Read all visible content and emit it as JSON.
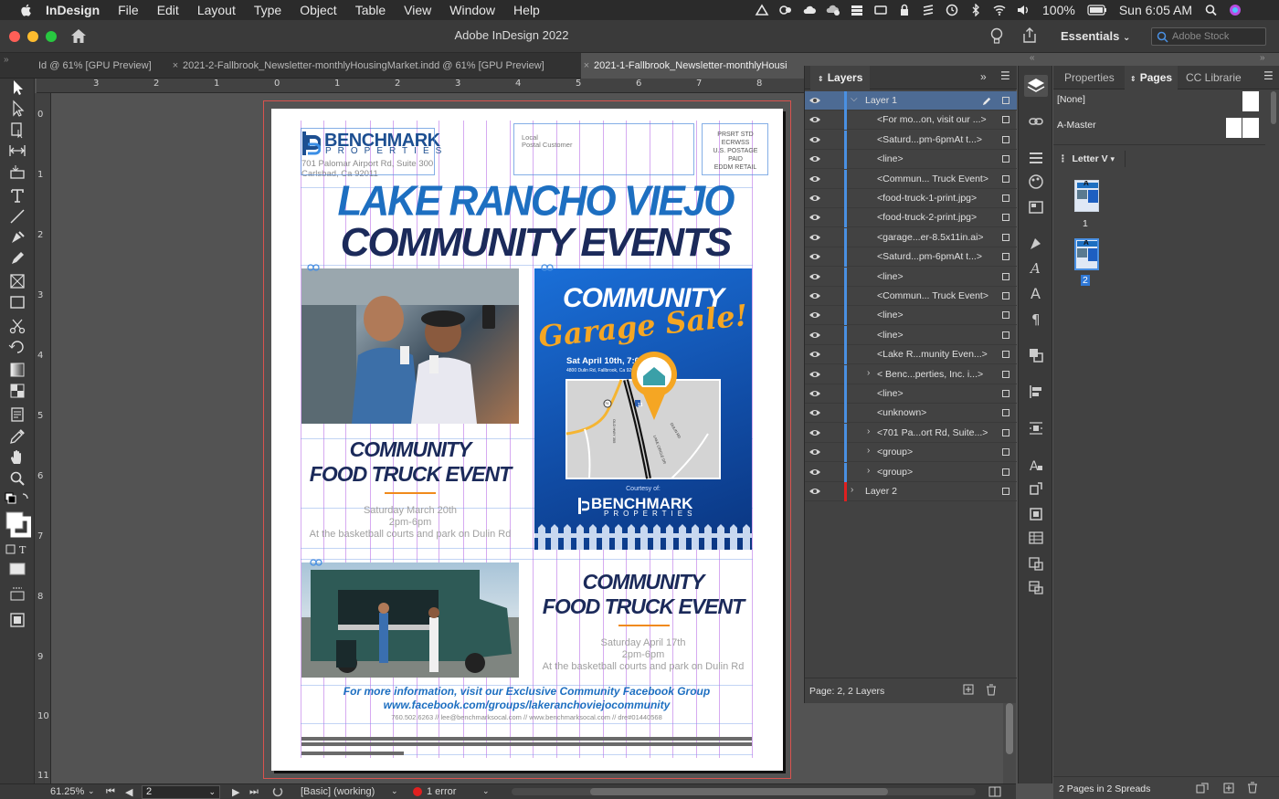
{
  "menubar": {
    "app_name": "InDesign",
    "items": [
      "File",
      "Edit",
      "Layout",
      "Type",
      "Object",
      "Table",
      "View",
      "Window",
      "Help"
    ],
    "battery": "100%",
    "clock": "Sun 6:05 AM"
  },
  "window": {
    "title": "Adobe InDesign 2022",
    "workspace": "Essentials",
    "search_placeholder": "Adobe Stock"
  },
  "tabs": [
    {
      "label": "Id @ 61% [GPU Preview]"
    },
    {
      "label": "2021-2-Fallbrook_Newsletter-monthlyHousingMarket.indd @ 61% [GPU Preview]"
    },
    {
      "label": "2021-1-Fallbrook_Newsletter-monthlyHousi"
    }
  ],
  "ruler": {
    "h_ticks": [
      "3",
      "2",
      "1",
      "0",
      "1",
      "2",
      "3",
      "4",
      "5",
      "6",
      "7",
      "8"
    ],
    "v_ticks": [
      "0",
      "1",
      "2",
      "3",
      "4",
      "5",
      "6",
      "7",
      "8",
      "9",
      "10",
      "11"
    ]
  },
  "newsletter": {
    "logo_name": "BENCHMARK",
    "logo_sub": "PROPERTIES",
    "address1": "701 Palomar Airport Rd, Suite 300",
    "address2": "Carlsbad, Ca 92011",
    "postal_line1": "Local",
    "postal_line2": "Postal Customer",
    "prsrt": [
      "PRSRT STD",
      "ECRWSS",
      "U.S. POSTAGE",
      "PAID",
      "EDDM RETAIL"
    ],
    "headline1": "LAKE RANCHO VIEJO",
    "headline2": "COMMUNITY EVENTS",
    "event1_title1": "COMMUNITY",
    "event1_title2": "FOOD TRUCK EVENT",
    "event1_date": "Saturday March 20th",
    "event1_time": "2pm-6pm",
    "event1_place": "At the basketball courts and park on Dulin Rd",
    "event2_title1": "COMMUNITY",
    "event2_title2": "FOOD TRUCK EVENT",
    "event2_date": "Saturday April 17th",
    "event2_time": "2pm-6pm",
    "event2_place": "At the basketball courts and park on Dulin Rd",
    "fb_line1": "For more information, visit our Exclusive Community Facebook Group",
    "fb_line2": "www.facebook.com/groups/lakeranchoviejocommunity",
    "contact": "760.502.6263  //  lee@benchmarksocal.com  //  www.benchmarksocal.com  //  dre#01440568"
  },
  "poster": {
    "title": "COMMUNITY",
    "script": "Garage Sale!",
    "date": "Sat April 10th, 7:00am",
    "address": "4800 Dulin Rd, Fallbrook, Ca 92028",
    "courtesy": "Courtesy of:",
    "brand": "BENCHMARK",
    "brand_sub": "PROPERTIES",
    "road_badge1": "76",
    "road_badge2": "15",
    "street1": "OLD HWY 395",
    "street2": "LAKE CIRCLE DR",
    "street3": "DULIN RD"
  },
  "statusbar": {
    "zoom": "61.25%",
    "page": "2",
    "preflight_profile": "[Basic] (working)",
    "errors": "1 error"
  },
  "layers": {
    "tab": "Layers",
    "rows": [
      {
        "label": "Layer 1",
        "level": 0,
        "expand": "open",
        "selected": true,
        "color": "#4a90e2"
      },
      {
        "label": "<For mo...on, visit our ...>",
        "level": 1,
        "expand": "",
        "color": "#4a90e2"
      },
      {
        "label": "<Saturd...pm-6pmAt t...>",
        "level": 1,
        "expand": "",
        "color": "#4a90e2"
      },
      {
        "label": "<line>",
        "level": 1,
        "expand": "",
        "color": "#4a90e2"
      },
      {
        "label": "<Commun... Truck Event>",
        "level": 1,
        "expand": "",
        "color": "#4a90e2"
      },
      {
        "label": "<food-truck-1-print.jpg>",
        "level": 1,
        "expand": "",
        "color": "#4a90e2"
      },
      {
        "label": "<food-truck-2-print.jpg>",
        "level": 1,
        "expand": "",
        "color": "#4a90e2"
      },
      {
        "label": "<garage...er-8.5x11in.ai>",
        "level": 1,
        "expand": "",
        "color": "#4a90e2"
      },
      {
        "label": "<Saturd...pm-6pmAt t...>",
        "level": 1,
        "expand": "",
        "color": "#4a90e2"
      },
      {
        "label": "<line>",
        "level": 1,
        "expand": "",
        "color": "#4a90e2"
      },
      {
        "label": "<Commun... Truck Event>",
        "level": 1,
        "expand": "",
        "color": "#4a90e2"
      },
      {
        "label": "<line>",
        "level": 1,
        "expand": "",
        "color": "#4a90e2"
      },
      {
        "label": "<line>",
        "level": 1,
        "expand": "",
        "color": "#4a90e2"
      },
      {
        "label": "<Lake R...munity Even...>",
        "level": 1,
        "expand": "",
        "color": "#4a90e2"
      },
      {
        "label": "<  Benc...perties, Inc. i...>",
        "level": 1,
        "expand": "closed",
        "color": "#4a90e2"
      },
      {
        "label": "<line>",
        "level": 1,
        "expand": "",
        "color": "#4a90e2"
      },
      {
        "label": "<unknown>",
        "level": 1,
        "expand": "",
        "color": "#4a90e2"
      },
      {
        "label": "<701 Pa...ort Rd, Suite...>",
        "level": 1,
        "expand": "closed",
        "color": "#4a90e2"
      },
      {
        "label": "<group>",
        "level": 1,
        "expand": "closed",
        "color": "#4a90e2"
      },
      {
        "label": "<group>",
        "level": 1,
        "expand": "closed",
        "color": "#4a90e2"
      },
      {
        "label": "Layer 2",
        "level": 0,
        "expand": "closed",
        "color": "#e02020"
      }
    ],
    "footer": "Page: 2, 2 Layers"
  },
  "pages_panel": {
    "tabs": [
      "Properties",
      "Pages",
      "CC Librarie"
    ],
    "masters": [
      "[None]",
      "A-Master"
    ],
    "size_label": "Letter V",
    "page_numbers": [
      "1",
      "2"
    ],
    "footer": "2 Pages in 2 Spreads"
  },
  "colors": {
    "accent_blue": "#1d6fc1",
    "navy": "#1b2a5a",
    "orange": "#f08a1c",
    "selection": "#4d6b94"
  }
}
